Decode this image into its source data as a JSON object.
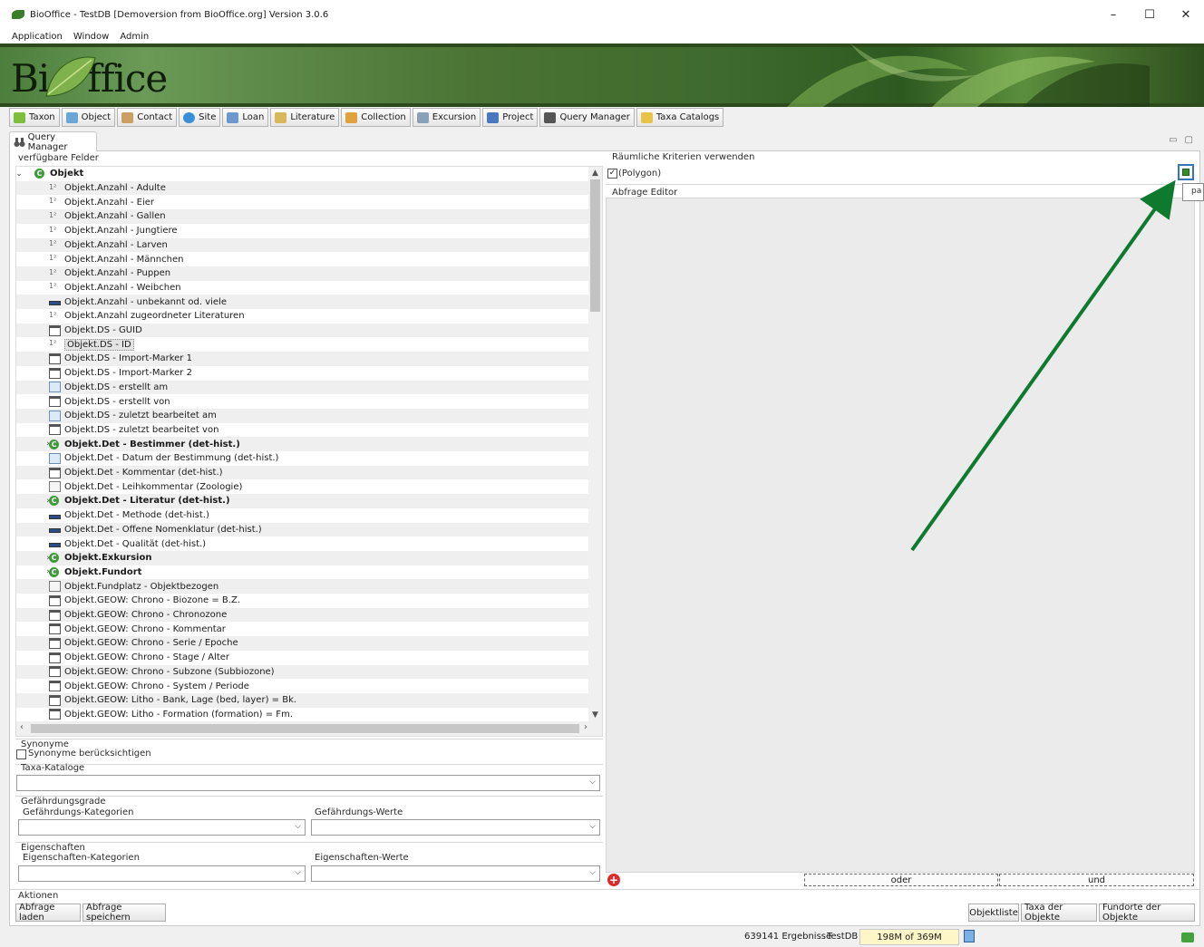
{
  "window": {
    "title": "BioOffice - TestDB [Demoversion from BioOffice.org] Version 3.0.6",
    "controls": {
      "minimize": "–",
      "maximize": "☐",
      "close": "✕"
    }
  },
  "menubar": [
    "Application",
    "Window",
    "Admin"
  ],
  "banner": {
    "logo_text_1": "Bi",
    "logo_text_2": "ffice"
  },
  "toolbar": [
    {
      "label": "Taxon",
      "icon": "leaf-icon",
      "color": "#7bbf3a"
    },
    {
      "label": "Object",
      "icon": "cube-icon",
      "color": "#6aa6d8"
    },
    {
      "label": "Contact",
      "icon": "person-icon",
      "color": "#caa064"
    },
    {
      "label": "Site",
      "icon": "globe-icon",
      "color": "#3a8fd9"
    },
    {
      "label": "Loan",
      "icon": "loan-icon",
      "color": "#6c98cf"
    },
    {
      "label": "Literature",
      "icon": "books-icon",
      "color": "#d9b85a"
    },
    {
      "label": "Collection",
      "icon": "drawer-icon",
      "color": "#e0a23c"
    },
    {
      "label": "Excursion",
      "icon": "car-icon",
      "color": "#8aa0b8"
    },
    {
      "label": "Project",
      "icon": "flag-icon",
      "color": "#4a78c0"
    },
    {
      "label": "Query Manager",
      "icon": "binoculars-icon",
      "color": "#555555"
    },
    {
      "label": "Taxa Catalogs",
      "icon": "folder-icon",
      "color": "#e8c34a"
    }
  ],
  "tab": {
    "label": "Query Manager",
    "icon": "binoculars-icon"
  },
  "view_controls": {
    "minimize": "▭",
    "maximize": "▢"
  },
  "fields": {
    "group_label": "verfügbare Felder",
    "rows": [
      {
        "label": "Objekt",
        "icon": "c",
        "twisty": "v",
        "level": 0,
        "bold": true
      },
      {
        "label": "Objekt.Anzahl - Adulte",
        "icon": "n",
        "level": 1
      },
      {
        "label": "Objekt.Anzahl - Eier",
        "icon": "n",
        "level": 1
      },
      {
        "label": "Objekt.Anzahl - Gallen",
        "icon": "n",
        "level": 1
      },
      {
        "label": "Objekt.Anzahl - Jungtiere",
        "icon": "n",
        "level": 1
      },
      {
        "label": "Objekt.Anzahl - Larven",
        "icon": "n",
        "level": 1
      },
      {
        "label": "Objekt.Anzahl - Männchen",
        "icon": "n",
        "level": 1
      },
      {
        "label": "Objekt.Anzahl - Puppen",
        "icon": "n",
        "level": 1
      },
      {
        "label": "Objekt.Anzahl - Weibchen",
        "icon": "n",
        "level": 1
      },
      {
        "label": "Objekt.Anzahl - unbekannt od. viele",
        "icon": "b",
        "level": 1
      },
      {
        "label": "Objekt.Anzahl zugeordneter Literaturen",
        "icon": "n",
        "level": 1
      },
      {
        "label": "Objekt.DS - GUID",
        "icon": "t",
        "level": 1
      },
      {
        "label": "Objekt.DS - ID",
        "icon": "n",
        "level": 1,
        "selected": true
      },
      {
        "label": "Objekt.DS - Import-Marker 1",
        "icon": "t",
        "level": 1
      },
      {
        "label": "Objekt.DS - Import-Marker 2",
        "icon": "t",
        "level": 1
      },
      {
        "label": "Objekt.DS - erstellt am",
        "icon": "d",
        "level": 1
      },
      {
        "label": "Objekt.DS - erstellt von",
        "icon": "t",
        "level": 1
      },
      {
        "label": "Objekt.DS - zuletzt bearbeitet am",
        "icon": "d",
        "level": 1
      },
      {
        "label": "Objekt.DS - zuletzt bearbeitet von",
        "icon": "t",
        "level": 1
      },
      {
        "label": "Objekt.Det - Bestimmer (det-hist.)",
        "icon": "c",
        "twisty": ">",
        "level": 1,
        "bold": true
      },
      {
        "label": "Objekt.Det - Datum der Bestimmung (det-hist.)",
        "icon": "d",
        "level": 1
      },
      {
        "label": "Objekt.Det - Kommentar (det-hist.)",
        "icon": "t",
        "level": 1
      },
      {
        "label": "Objekt.Det - Leihkommentar (Zoologie)",
        "icon": "p",
        "level": 1
      },
      {
        "label": "Objekt.Det - Literatur (det-hist.)",
        "icon": "c",
        "twisty": ">",
        "level": 1,
        "bold": true
      },
      {
        "label": "Objekt.Det - Methode (det-hist.)",
        "icon": "b",
        "level": 1
      },
      {
        "label": "Objekt.Det - Offene Nomenklatur (det-hist.)",
        "icon": "b",
        "level": 1
      },
      {
        "label": "Objekt.Det - Qualität (det-hist.)",
        "icon": "b",
        "level": 1
      },
      {
        "label": "Objekt.Exkursion",
        "icon": "c",
        "twisty": ">",
        "level": 1,
        "bold": true
      },
      {
        "label": "Objekt.Fundort",
        "icon": "c",
        "twisty": ">",
        "level": 1,
        "bold": true
      },
      {
        "label": "Objekt.Fundplatz - Objektbezogen",
        "icon": "p",
        "level": 1
      },
      {
        "label": "Objekt.GEOW: Chrono - Biozone = B.Z.",
        "icon": "t",
        "level": 1
      },
      {
        "label": "Objekt.GEOW: Chrono - Chronozone",
        "icon": "t",
        "level": 1
      },
      {
        "label": "Objekt.GEOW: Chrono - Kommentar",
        "icon": "t",
        "level": 1
      },
      {
        "label": "Objekt.GEOW: Chrono - Serie / Epoche",
        "icon": "t",
        "level": 1
      },
      {
        "label": "Objekt.GEOW: Chrono - Stage / Alter",
        "icon": "t",
        "level": 1
      },
      {
        "label": "Objekt.GEOW: Chrono - Subzone (Subbiozone)",
        "icon": "t",
        "level": 1
      },
      {
        "label": "Objekt.GEOW: Chrono - System / Periode",
        "icon": "t",
        "level": 1
      },
      {
        "label": "Objekt.GEOW: Litho - Bank, Lage (bed, layer) = Bk.",
        "icon": "t",
        "level": 1
      },
      {
        "label": "Objekt.GEOW: Litho - Formation (formation) = Fm.",
        "icon": "t",
        "level": 1
      }
    ]
  },
  "synonyme": {
    "group_label": "Synonyme",
    "checkbox_label": "Synonyme berücksichtigen",
    "checked": false
  },
  "taxa_kataloge": {
    "group_label": "Taxa-Kataloge",
    "value": ""
  },
  "gefaehrdung": {
    "group_label": "Gefährdungsgrade",
    "kategorien_label": "Gefährdungs-Kategorien",
    "werte_label": "Gefährdungs-Werte"
  },
  "eigenschaften": {
    "group_label": "Eigenschaften",
    "kategorien_label": "Eigenschaften-Kategorien",
    "werte_label": "Eigenschaften-Werte"
  },
  "aktionen": {
    "group_label": "Aktionen",
    "load": "Abfrage laden",
    "save": "Abfrage speichern"
  },
  "raeumlich": {
    "group_label": "Räumliche Kriterien verwenden",
    "checkbox_label": "(Polygon)",
    "checked": true
  },
  "tooltip_text": "pa",
  "abfrage_editor": {
    "group_label": "Abfrage Editor"
  },
  "bool_bar": {
    "oder": "oder",
    "und": "und"
  },
  "result_buttons": [
    "Objektliste",
    "Taxa der Objekte",
    "Fundorte der Objekte"
  ],
  "status": {
    "results": "639141 Ergebnisse",
    "db": "TestDB",
    "memory": "198M of 369M"
  },
  "colors": {
    "banner_green": "#4d7e3c",
    "annotation_arrow": "#0d7a2e",
    "selection": "#e3e3e3"
  }
}
